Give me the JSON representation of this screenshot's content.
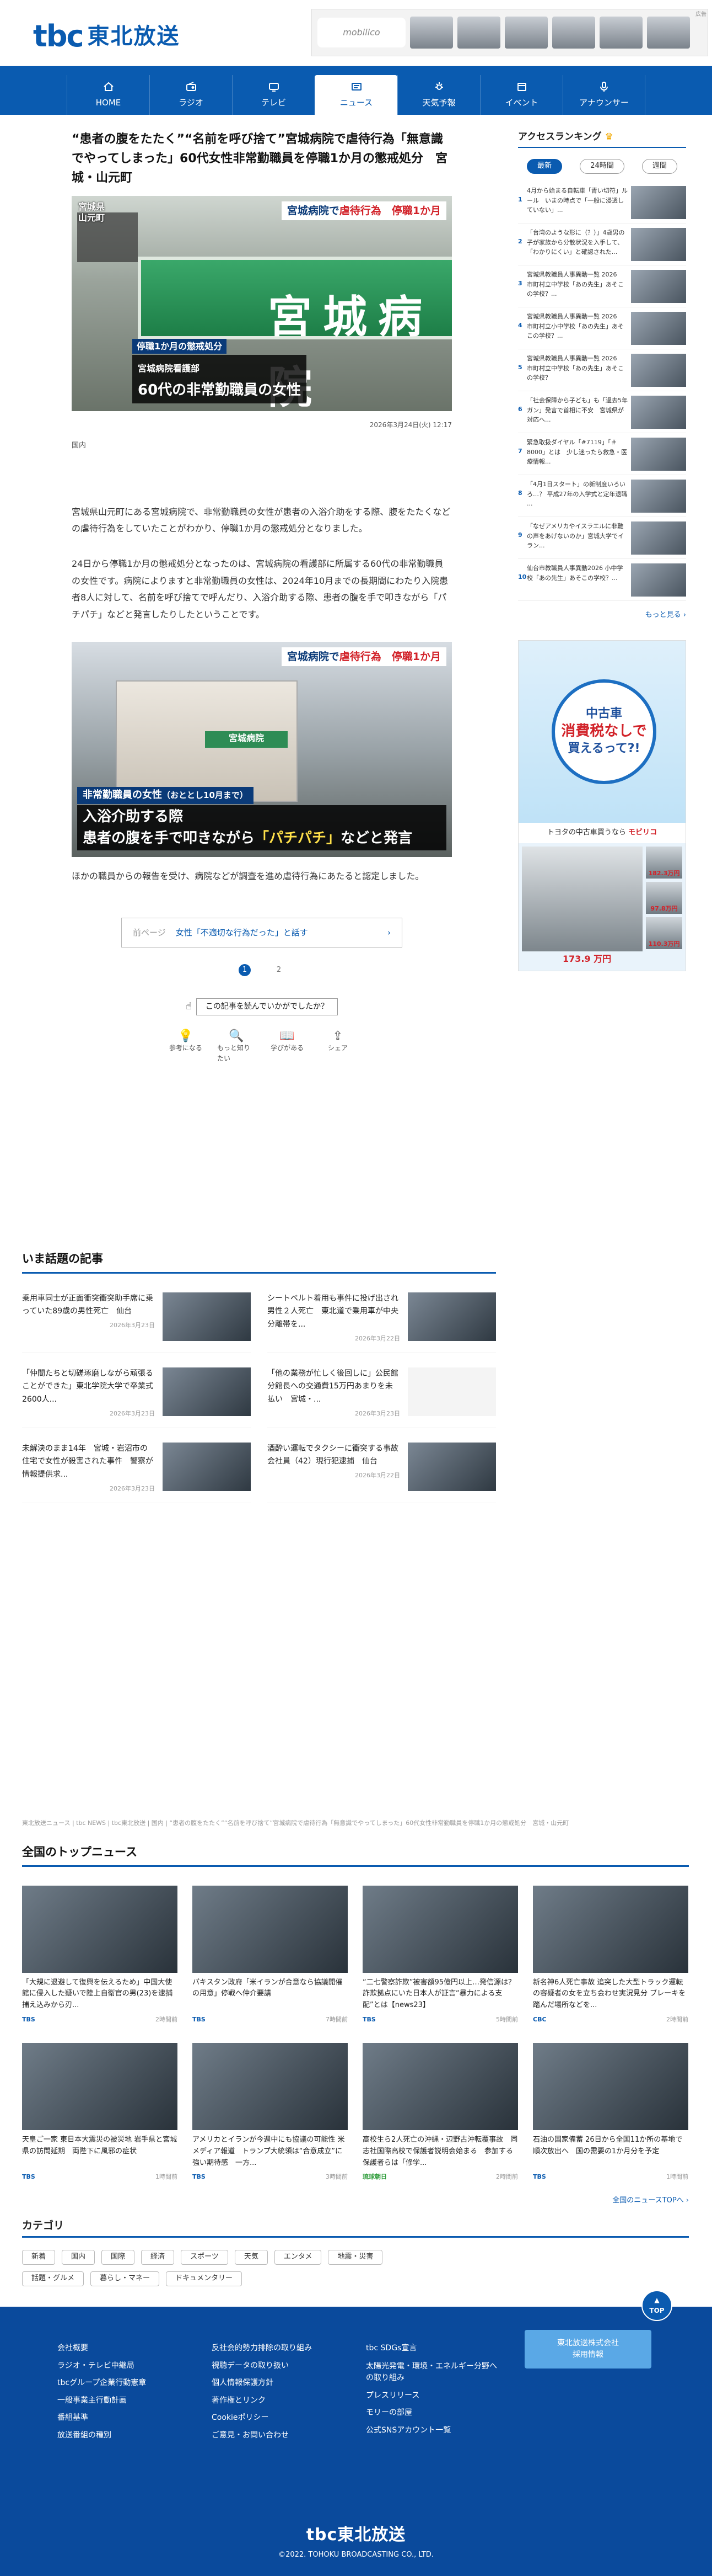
{
  "site": {
    "logo_mark": "tbc",
    "logo_text": "東北放送",
    "brand_color": "#0a5bb0"
  },
  "header_ad": {
    "brand": "mobilico",
    "tag": "広告"
  },
  "nav": [
    {
      "label": "HOME",
      "icon": "home-icon"
    },
    {
      "label": "ラジオ",
      "icon": "radio-icon"
    },
    {
      "label": "テレビ",
      "icon": "tv-icon"
    },
    {
      "label": "ニュース",
      "icon": "news-icon",
      "active": true
    },
    {
      "label": "天気予報",
      "icon": "weather-icon"
    },
    {
      "label": "イベント",
      "icon": "calendar-icon"
    },
    {
      "label": "アナウンサー",
      "icon": "microphone-icon"
    }
  ],
  "article": {
    "title": "“患者の腹をたたく”“名前を呼び捨て”宮城病院で虐待行為「無意識でやってしまった」60代女性非常勤職員を停職1か月の懲戒処分　宮城・山元町",
    "hero": {
      "sign": "宮城病院",
      "top_caption_prefix": "宮城病院で",
      "top_caption_red": "虐待行為",
      "top_caption_suffix": "停職1か月",
      "top_left": "宮城県\n山元町",
      "bottom_line1": "停職1か月の懲戒処分",
      "bottom_line2_small": "宮城病院看護部",
      "bottom_line2": "60代の非常勤職員の女性"
    },
    "date": "2026年3月24日(火) 12:17",
    "category": "国内",
    "paragraphs": [
      "宮城県山元町にある宮城病院で、非常勤職員の女性が患者の入浴介助をする際、腹をたたくなどの虐待行為をしていたことがわかり、停職1か月の懲戒処分となりました。",
      "24日から停職1か月の懲戒処分となったのは、宮城病院の看護部に所属する60代の非常勤職員の女性です。病院によりますと非常勤職員の女性は、2024年10月までの長期間にわたり入院患者8人に対して、名前を呼び捨てで呼んだり、入浴介助する際、患者の腹を手で叩きながら「パチパチ」などと発言したりしたということです。"
    ],
    "figure2": {
      "sign": "宮城病院",
      "top_caption_prefix": "宮城病院で",
      "top_caption_red": "虐待行為",
      "top_caption_suffix": "停職1か月",
      "label": "非常勤職員の女性",
      "label_small": "（おととし10月まで）",
      "line1": "入浴介助する際",
      "line2_prefix": "患者の腹を手で叩きながら",
      "line2_em": "「パチパチ」",
      "line2_suffix": "などと発言"
    },
    "after": "ほかの職員からの報告を受け、病院などが調査を進め虐待行為にあたると認定しました。",
    "prev_label": "前ページ",
    "prev_link": "女性「不適切な行為だった」と話す",
    "pages": [
      "1",
      "2"
    ],
    "feedback_q": "この記事を読んでいかがでしたか？",
    "feedback_btns": [
      {
        "label": "参考になる",
        "icon": "lightbulb-icon",
        "glyph": "💡"
      },
      {
        "label": "もっと知りたい",
        "icon": "search-icon",
        "glyph": "🔍"
      },
      {
        "label": "学びがある",
        "icon": "book-icon",
        "glyph": "📖"
      },
      {
        "label": "シェア",
        "icon": "share-icon",
        "glyph": "⇪"
      }
    ]
  },
  "ranking": {
    "title": "アクセスランキング",
    "tabs": [
      "最新",
      "24時間",
      "週間"
    ],
    "items": [
      {
        "n": "1",
        "text": "4月から始まる自転車「青い切符」ルール　いまの時点で「一般に浸透していない」..."
      },
      {
        "n": "2",
        "text": "「台湾のような形に（？）」4歳男の子が家族から分散状況を入手して、「わかりにくい」と確認された..."
      },
      {
        "n": "3",
        "text": "宮城県教職員人事異動一覧 2026　市町村立中学校「あの先生」あそこの学校？..."
      },
      {
        "n": "4",
        "text": "宮城県教職員人事異動一覧 2026　市町村立小中学校「あの先生」あそこの学校？..."
      },
      {
        "n": "5",
        "text": "宮城県教職員人事異動一覧 2026　市町村立中学校「あの先生」あそこの学校？"
      },
      {
        "n": "6",
        "text": "「社会保障から子ども」も「過去5年ガン」発言で首相に不安　宮城県が対応へ..."
      },
      {
        "n": "7",
        "text": "緊急取扱ダイヤル「#7119」「＃8000」とは　少し迷ったら救急・医療情報..."
      },
      {
        "n": "8",
        "text": "「4月1日スタート」の新制度いろいろ…？ 平成27年の入学式と定年退職 ..."
      },
      {
        "n": "9",
        "text": "「なぜアメリカやイスラエルに非難の声をあげないのか」宮城大学でイラン..."
      },
      {
        "n": "10",
        "text": "仙台市教職員人事異動2026 小中学校「あの先生」あそこの学校？..."
      }
    ],
    "more": "もっと見る ›"
  },
  "side_ad": {
    "burst_top": "中古車",
    "burst_mid": "消費税なしで",
    "burst_bottom": "買えるって?!",
    "line_prefix": "トヨタの中古車買うなら",
    "line_em": "モビリコ",
    "price": "173.9 万円",
    "prices": [
      "182.3万円",
      "97.8万円",
      "110.3万円"
    ]
  },
  "hot": {
    "title": "いま話題の記事",
    "items": [
      {
        "text": "乗用車同士が正面衝突衝突助手席に乗っていた89歳の男性死亡　仙台",
        "date": "2026年3月23日"
      },
      {
        "text": "シートベルト着用も事件に投げ出され男性２人死亡　東北道で乗用車が中央分離帯を...",
        "date": "2026年3月22日"
      },
      {
        "text": "「仲間たちと切磋琢磨しながら頑張ることができた」東北学院大学で卒業式　2600人...",
        "date": "2026年3月23日"
      },
      {
        "text": "「他の業務が忙しく後回しに」公民館分館長への交通費15万円あまりを未払い　宮城・...",
        "date": "2026年3月23日"
      },
      {
        "text": "未解決のまま14年　宮城・岩沼市の住宅で女性が殺害された事件　警察が情報提供求...",
        "date": "2026年3月23日"
      },
      {
        "text": "酒酔い運転でタクシーに衝突する事故　会社員（42）現行犯逮捕　仙台",
        "date": "2026年3月22日"
      }
    ]
  },
  "breadcrumb": "東北放送ニュース | tbc NEWS | tbc東北放送 | 国内 | “患者の腹をたたく”“名前を呼び捨て”宮城病院で虐待行為「無意識でやってしまった」60代女性非常勤職員を停職1か月の懲戒処分　宮城・山元町",
  "topnews": {
    "title": "全国のトップニュース",
    "items": [
      {
        "text": "「大規に退避して復興を伝えるため」中国大使館に侵入した疑いで陸上自衛官の男(23)を逮捕　捕え込みから刃...",
        "src": "TBS",
        "time": "2時間前"
      },
      {
        "text": "パキスタン政府「米イランが合意なら協議開催の用意」停戦へ仲介要請",
        "src": "TBS",
        "time": "7時間前"
      },
      {
        "text": "“二七警察詐欺”被害額95億円以上…発信源は？ 詐欺拠点にいた日本人が証言“暴力による支配”とは【news23】",
        "src": "TBS",
        "time": "5時間前"
      },
      {
        "text": "新名神6人死亡事故 追突した大型トラック運転の容疑者の女を立ち会わせ実況見分 ブレーキを踏んだ場所などを...",
        "src": "CBC",
        "time": "2時間前"
      },
      {
        "text": "天皇ご一家 東日本大震災の被災地 岩手県と宮城県の訪問延期　両陛下に風邪の症状",
        "src": "TBS",
        "time": "1時間前"
      },
      {
        "text": "アメリカとイランが今週中にも協議の可能性 米メディア報道　トランプ大統領は“合意成立”に強い期待感　一方...",
        "src": "TBS",
        "time": "3時間前"
      },
      {
        "text": "高校生ら2人死亡の沖縄・辺野古沖転覆事故　同志社国際高校で保護者説明会始まる　参加する保護者らは「修学...",
        "src": "琉球朝日",
        "time": "2時間前"
      },
      {
        "text": "石油の国家備蓄 26日から全国11か所の基地で順次放出へ　国の需要の1か月分を予定",
        "src": "TBS",
        "time": "1時間前"
      }
    ],
    "more": "全国のニュースTOPへ ›"
  },
  "categories": {
    "title": "カテゴリ",
    "items": [
      "新着",
      "国内",
      "国際",
      "経済",
      "スポーツ",
      "天気",
      "エンタメ",
      "地震・災害",
      "話題・グルメ",
      "暮らし・マネー",
      "ドキュメンタリー"
    ]
  },
  "footer": {
    "to_top": "TOP",
    "col1": [
      "会社概要",
      "ラジオ・テレビ中継局",
      "tbcグループ企業行動憲章",
      "一般事業主行動計画",
      "番組基準",
      "放送番組の種別"
    ],
    "col2": [
      "反社会的勢力排除の取り組み",
      "視聴データの取り扱い",
      "個人情報保護方針",
      "著作権とリンク",
      "Cookieポリシー",
      "ご意見・お問い合わせ"
    ],
    "col3": [
      "tbc SDGs宣言",
      "太陽光発電・環境・エネルギー分野への取り組み",
      "プレスリリース",
      "モリーの部屋",
      "公式SNSアカウント一覧"
    ],
    "recruit": "東北放送株式会社\n採用情報",
    "logo": "tbc東北放送",
    "copyright": "©2022. TOHOKU BROADCASTING CO., LTD."
  }
}
